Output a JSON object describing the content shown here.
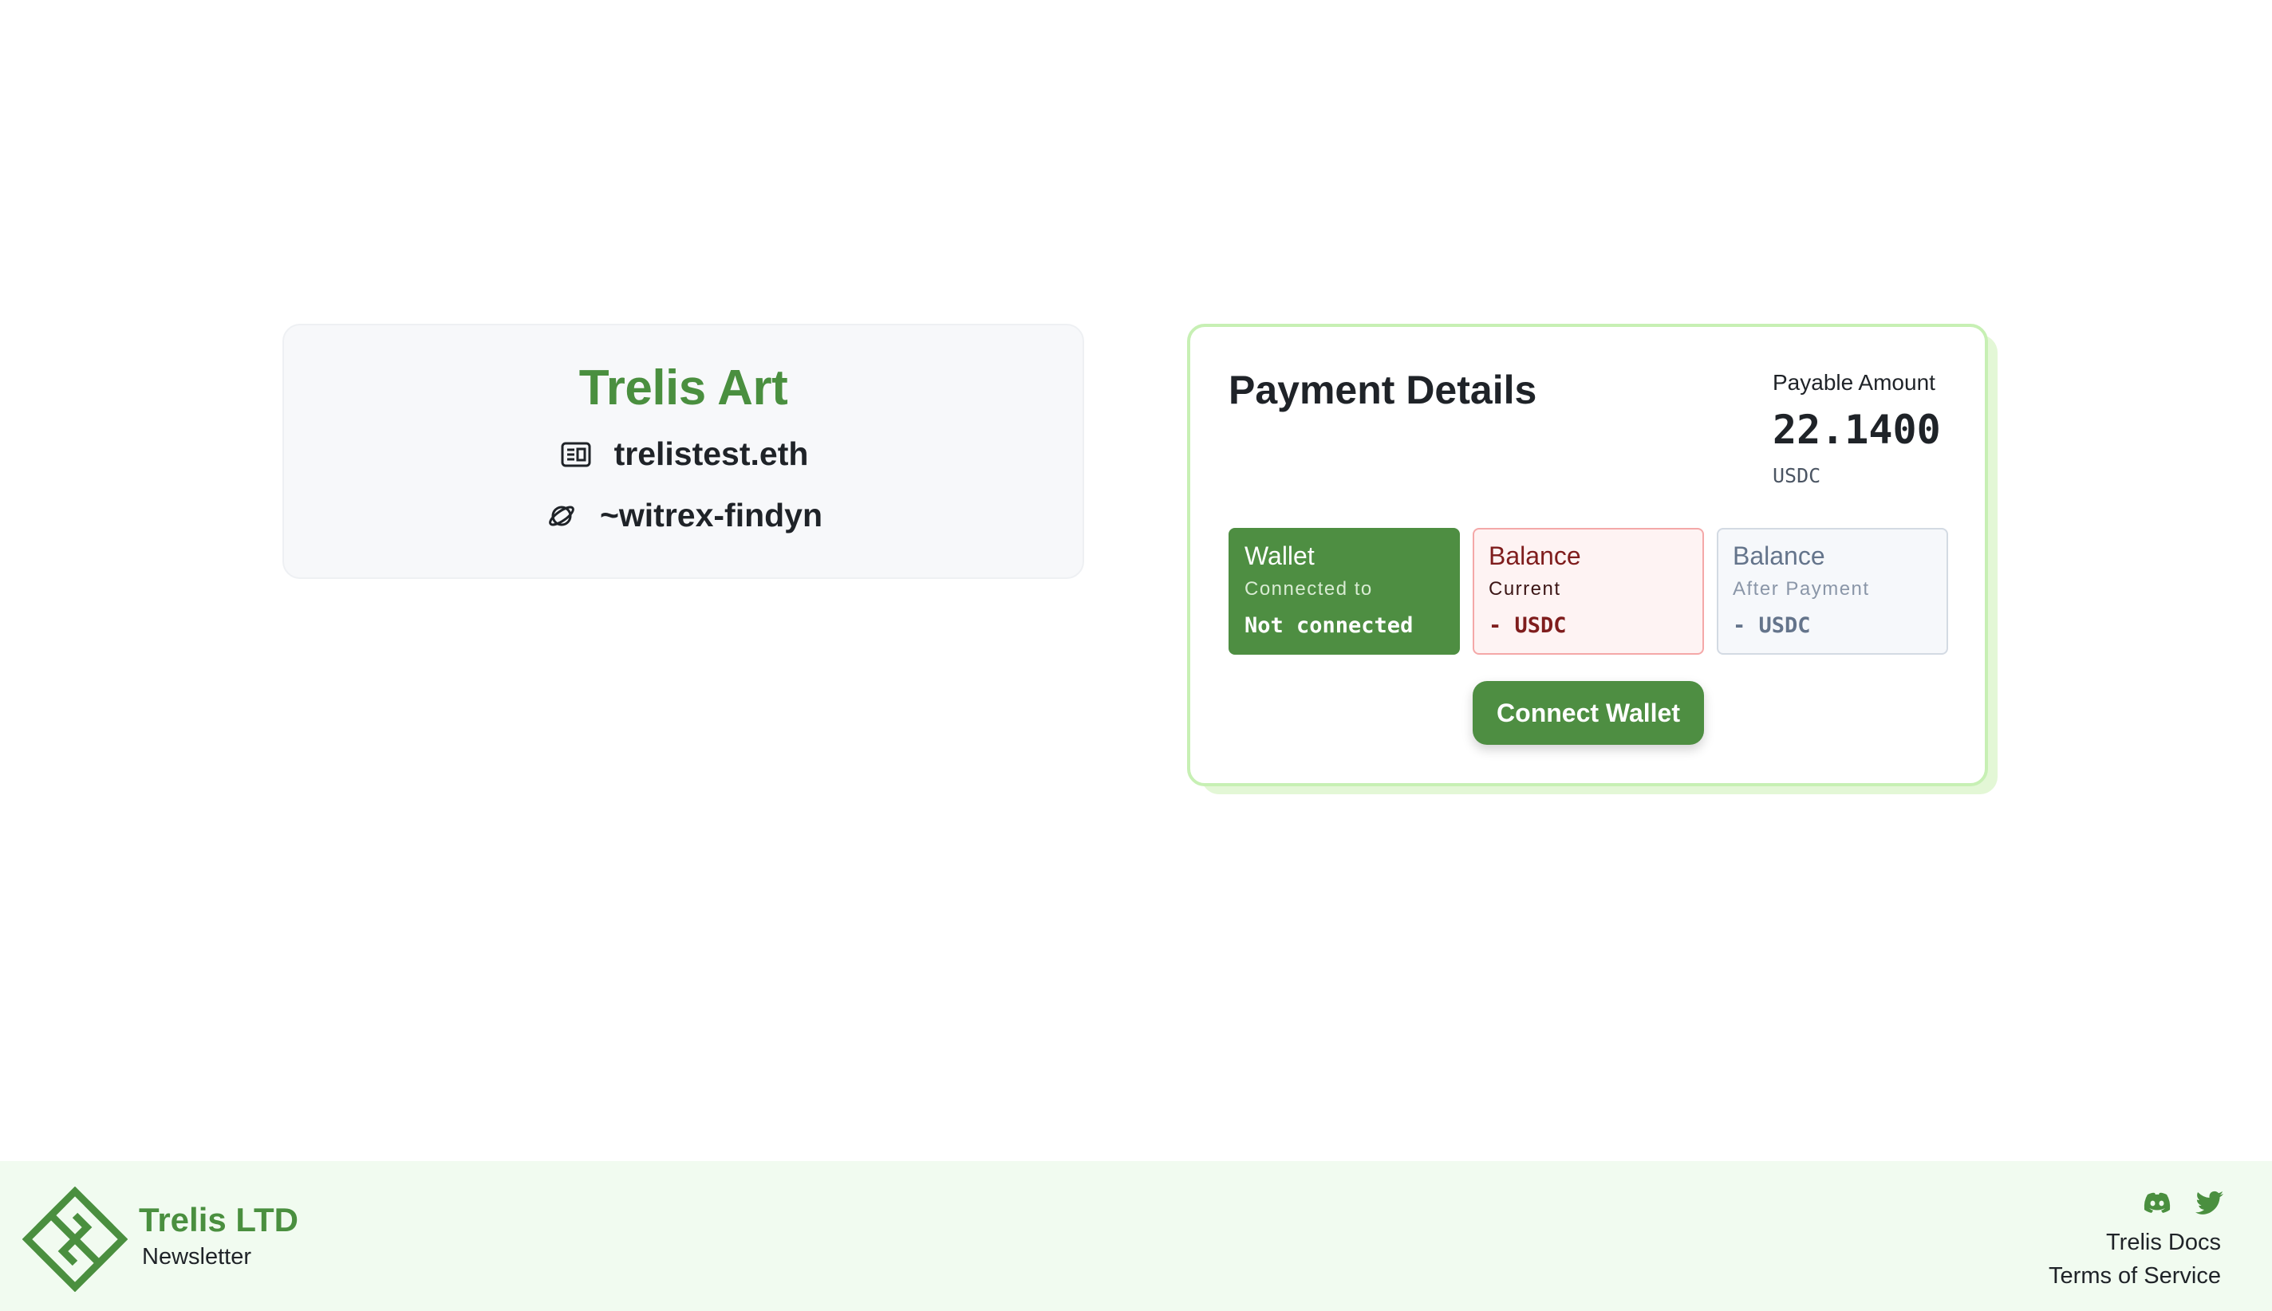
{
  "merchant": {
    "name": "Trelis Art",
    "ens": "trelistest.eth",
    "urbit_id": "~witrex-findyn",
    "ens_icon": "id-card-icon",
    "urbit_icon": "planet-icon"
  },
  "payment": {
    "title": "Payment Details",
    "payable_label": "Payable Amount",
    "amount": "22.1400",
    "currency": "USDC",
    "tiles": {
      "wallet": {
        "title": "Wallet",
        "subtitle": "Connected to",
        "value": "Not connected"
      },
      "balance_current": {
        "title": "Balance",
        "subtitle": "Current",
        "value": "- USDC"
      },
      "balance_after": {
        "title": "Balance",
        "subtitle": "After Payment",
        "value": "- USDC"
      }
    },
    "connect_button": "Connect Wallet"
  },
  "footer": {
    "brand": "Trelis LTD",
    "newsletter": "Newsletter",
    "docs": "Trelis Docs",
    "terms": "Terms of Service",
    "icons": [
      "discord-icon",
      "twitter-icon"
    ]
  },
  "colors": {
    "brand_green": "#4a8f3f",
    "button_green": "#4e8e42",
    "card_border": "#c7f0b4",
    "footer_bg": "#f1fbf0",
    "balance_border": "#f4a8a8"
  }
}
